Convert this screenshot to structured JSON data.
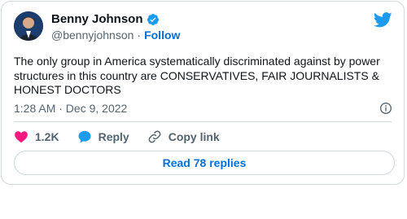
{
  "author": {
    "name": "Benny Johnson",
    "handle": "@bennyjohnson",
    "separator": "·",
    "follow_label": "Follow"
  },
  "tweet": {
    "text": "The only group in America systematically discriminated against by power structures in this country are CONSERVATIVES, FAIR JOURNALISTS & HONEST DOCTORS",
    "timestamp": "1:28 AM · Dec 9, 2022"
  },
  "actions": {
    "likes_count": "1.2K",
    "reply_label": "Reply",
    "copy_link_label": "Copy link",
    "read_replies_label": "Read 78 replies"
  },
  "icons": {
    "brand": "twitter-bird-icon",
    "verified": "verified-badge-icon",
    "info": "info-icon",
    "like": "heart-icon",
    "reply": "reply-bubble-icon",
    "copy": "link-icon"
  },
  "colors": {
    "brand_blue": "#1d9bf0",
    "link_blue": "#006fd6",
    "like_red": "#f91880",
    "muted_text": "#536471",
    "border": "#cfd9de"
  }
}
